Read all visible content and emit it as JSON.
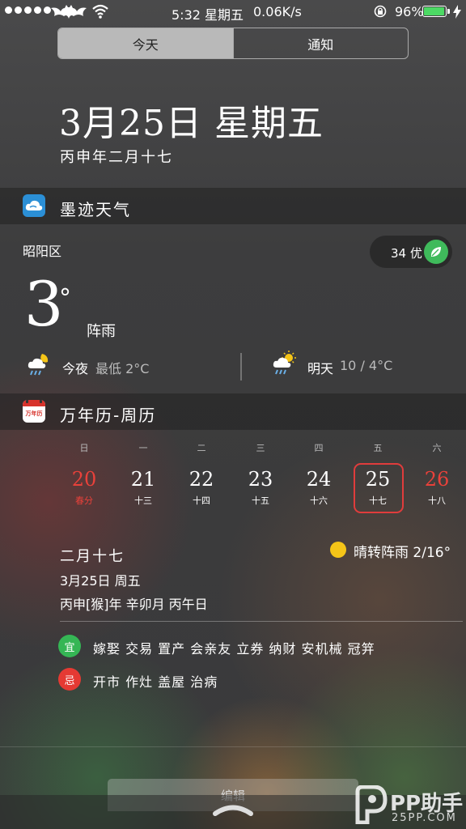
{
  "status_bar": {
    "time": "5:32 星期五",
    "speed": "0.06K/s",
    "battery_percent": "96%",
    "battery_level": 0.96,
    "battery_color": "#4cd964"
  },
  "tabs": [
    {
      "label": "今天",
      "active": true
    },
    {
      "label": "通知",
      "active": false
    }
  ],
  "date_header": {
    "title": "3月25日 星期五",
    "lunar": "丙申年二月十七"
  },
  "weather": {
    "app_name": "墨迹天气",
    "app_icon": "cloud-icon",
    "location": "昭阳区",
    "aqi": "34 优",
    "temp": "3",
    "condition": "阵雨",
    "tonight_label": "今夜",
    "tonight_value": "最低 2°C",
    "tomorrow_label": "明天",
    "tomorrow_value": "10 / 4°C"
  },
  "calendar": {
    "app_name": "万年历-周历",
    "app_icon_text": "万年历",
    "weekdays": [
      "日",
      "一",
      "二",
      "三",
      "四",
      "五",
      "六"
    ],
    "days": [
      {
        "num": "20",
        "sub": "春分"
      },
      {
        "num": "21",
        "sub": "十三"
      },
      {
        "num": "22",
        "sub": "十四"
      },
      {
        "num": "23",
        "sub": "十五"
      },
      {
        "num": "24",
        "sub": "十六"
      },
      {
        "num": "25",
        "sub": "十七"
      },
      {
        "num": "26",
        "sub": "十八"
      }
    ],
    "selected_day": "25",
    "accent_red": "#e03c3c",
    "detail": {
      "lunar": "二月十七",
      "date": "3月25日  周五",
      "ganzhi": "丙申[猴]年  辛卯月  丙午日",
      "weather": "晴转阵雨 2/16°"
    },
    "good_label": "宜",
    "good_items": "嫁娶 交易 置产 会亲友 立券 纳财 安机械 冠笄",
    "good_color": "#35b655",
    "bad_label": "忌",
    "bad_items": "开市 作灶 盖屋 治病",
    "bad_color": "#e53a33"
  },
  "footer": {
    "edit_label": "编辑",
    "watermark": "PP助手",
    "watermark_sub": "25PP.COM"
  }
}
